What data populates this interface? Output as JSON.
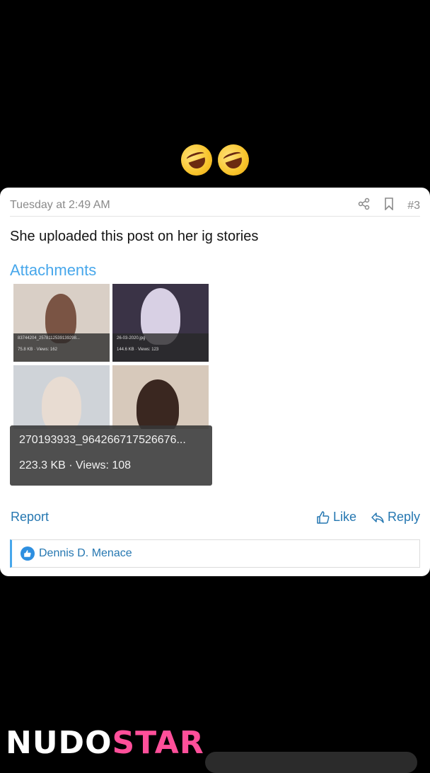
{
  "post": {
    "timestamp": "Tuesday at 2:49 AM",
    "post_number": "#3",
    "text": "She uploaded this post on her ig stories",
    "attachments_title": "Attachments",
    "attachments": [
      {
        "filename": "83744204_2578112539139298...",
        "info": "75.8 KB · Views: 162"
      },
      {
        "filename": "26-03-2020.jpg",
        "info": "144.6 KB · Views: 123"
      },
      {
        "filename": "270193933_964266717526676...",
        "info": "223.3 KB · Views: 108"
      }
    ]
  },
  "actions": {
    "report": "Report",
    "like": "Like",
    "reply": "Reply"
  },
  "reactions": {
    "user": "Dennis D. Menace"
  },
  "watermark": {
    "part1": "NUDO",
    "part2": "STAR"
  },
  "colors": {
    "accent": "#47a7eb",
    "link": "#2577b1",
    "watermark_pink": "#ff4f9a"
  }
}
